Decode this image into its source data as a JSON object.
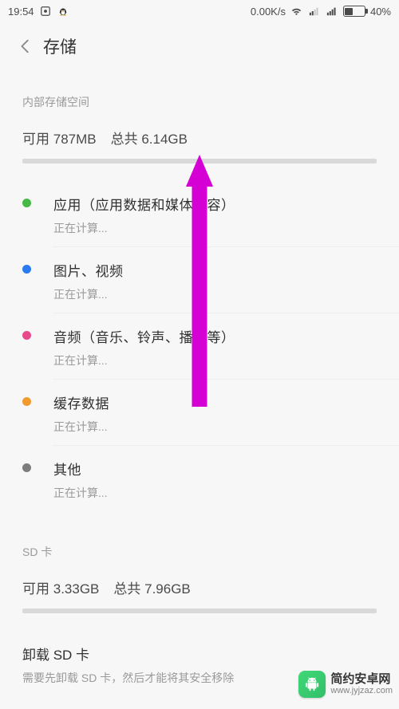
{
  "status": {
    "time": "19:54",
    "net_speed": "0.00K/s",
    "battery_pct": "40%"
  },
  "appbar": {
    "title": "存储"
  },
  "internal": {
    "section_label": "内部存储空间",
    "available_label": "可用",
    "available_value": "787MB",
    "total_label": "总共",
    "total_value": "6.14GB"
  },
  "categories": [
    {
      "dot": "dot-green",
      "title": "应用（应用数据和媒体内容）",
      "sub": "正在计算..."
    },
    {
      "dot": "dot-blue",
      "title": "图片、视频",
      "sub": "正在计算..."
    },
    {
      "dot": "dot-pink",
      "title": "音频（音乐、铃声、播客等）",
      "sub": "正在计算..."
    },
    {
      "dot": "dot-orange",
      "title": "缓存数据",
      "sub": "正在计算..."
    },
    {
      "dot": "dot-grey",
      "title": "其他",
      "sub": "正在计算..."
    }
  ],
  "sd": {
    "section_label": "SD 卡",
    "available_label": "可用",
    "available_value": "3.33GB",
    "total_label": "总共",
    "total_value": "7.96GB",
    "unmount_title": "卸载 SD 卡",
    "unmount_sub": "需要先卸载 SD 卡，然后才能将其安全移除"
  },
  "watermark": {
    "line1": "简约安卓网",
    "line2": "www.jyjzaz.com"
  }
}
